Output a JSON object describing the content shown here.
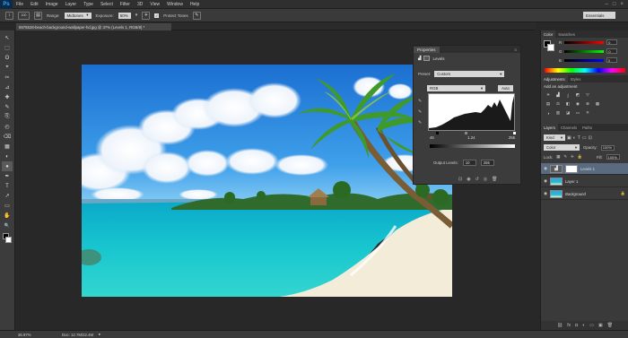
{
  "app": {
    "logo": "Ps"
  },
  "menu": [
    "File",
    "Edit",
    "Image",
    "Layer",
    "Type",
    "Select",
    "Filter",
    "3D",
    "View",
    "Window",
    "Help"
  ],
  "window_controls": [
    "–",
    "□",
    "×"
  ],
  "options_bar": {
    "tool_icon": "↕",
    "brush_size": "100",
    "range_label": "Range:",
    "range_value": "Midtones",
    "exposure_label": "Exposure:",
    "exposure_value": "50%",
    "protect_tones": "Protect Tones",
    "workspace": "Essentials"
  },
  "document_tab": "6975528-beach-background-wallpaper-hd.jpg @ 37% (Levels 1, RGB/8) *",
  "status": {
    "zoom": "36.97%",
    "doc": "Doc: 12.7M/22.4M"
  },
  "tools": [
    "↖",
    "⬚",
    "ʘ",
    "⌖",
    "✂",
    "⊿",
    "✚",
    "✎",
    "⎘",
    "◴",
    "⌫",
    "▦",
    "◐",
    "●",
    "✒",
    "T",
    "↗",
    "▭",
    "✋",
    "🔍"
  ],
  "properties": {
    "tab": "Properties",
    "type": "Levels",
    "preset_label": "Preset:",
    "preset_value": "Custom",
    "channel": "RGB",
    "auto": "Auto",
    "input_black": "46",
    "input_gamma": "1.24",
    "input_white": "255",
    "output_label": "Output Levels:",
    "output_black": "10",
    "output_white": "255"
  },
  "color_panel": {
    "tabs": [
      "Color",
      "Swatches"
    ],
    "r_label": "R",
    "g_label": "G",
    "b_label": "B",
    "r": "0",
    "g": "0",
    "b": "0"
  },
  "adjustments": {
    "tabs": [
      "Adjustments",
      "Styles"
    ],
    "title": "Add an adjustment"
  },
  "layers": {
    "tabs": [
      "Layers",
      "Channels",
      "Paths"
    ],
    "kind": "Kind",
    "blend": "Color",
    "opacity_label": "Opacity:",
    "opacity": "100%",
    "lock_label": "Lock:",
    "fill_label": "Fill:",
    "fill": "100%",
    "items": [
      {
        "name": "Levels 1"
      },
      {
        "name": "Layer 1"
      },
      {
        "name": "Background"
      }
    ]
  }
}
